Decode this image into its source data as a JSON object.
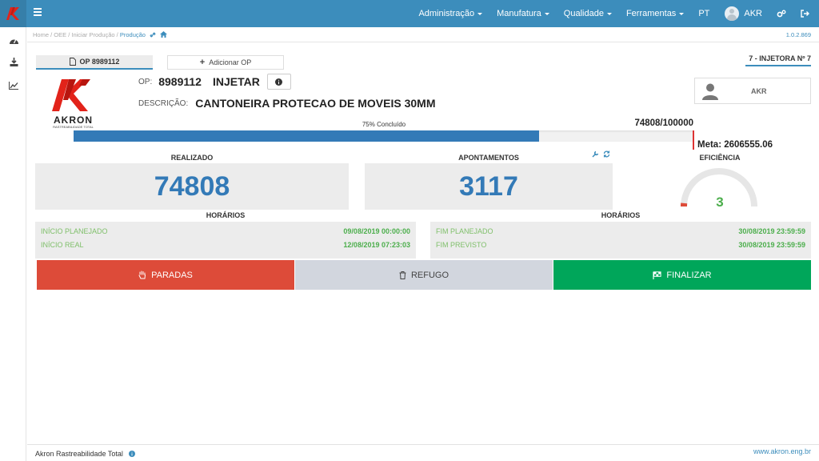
{
  "header": {
    "menu": [
      {
        "label": "Administração"
      },
      {
        "label": "Manufatura"
      },
      {
        "label": "Qualidade"
      },
      {
        "label": "Ferramentas"
      }
    ],
    "language": "PT",
    "user": "AKR"
  },
  "breadcrumb": {
    "items": [
      "Home",
      "OEE",
      "Iniciar Produção"
    ],
    "current": "Produção",
    "separator": " / "
  },
  "version": "1.0.2.869",
  "tabs": {
    "op_label": "OP 8989112",
    "add_label": "Adicionar OP"
  },
  "machine": "7 - INJETORA Nº 7",
  "brand": {
    "name": "AKRON",
    "tagline": "RASTREABILIDADE TOTAL"
  },
  "order": {
    "op_label": "OP:",
    "op_number": "8989112",
    "operation": "INJETAR",
    "desc_label": "DESCRIÇÃO:",
    "description": "CANTONEIRA PROTECAO DE MOVEIS 30MM"
  },
  "operator": {
    "name": "AKR"
  },
  "progress": {
    "label": "75% Concluído",
    "count": "74808/100000",
    "fraction": 0.75,
    "meta": "Meta: 2606555.06"
  },
  "realizado": {
    "title": "REALIZADO",
    "value": "74808"
  },
  "apontamentos": {
    "title": "APONTAMENTOS",
    "value": "3117"
  },
  "eficiencia": {
    "title": "EFICIÊNCIA",
    "value": "3",
    "fraction": 0.03
  },
  "horarios_left": {
    "title": "HORÁRIOS",
    "rows": [
      {
        "label": "INÍCIO PLANEJADO",
        "value": "09/08/2019 00:00:00"
      },
      {
        "label": "INÍCIO REAL",
        "value": "12/08/2019 07:23:03"
      }
    ]
  },
  "horarios_right": {
    "title": "HORÁRIOS",
    "rows": [
      {
        "label": "FIM PLANEJADO",
        "value": "30/08/2019 23:59:59"
      },
      {
        "label": "FIM PREVISTO",
        "value": "30/08/2019 23:59:59"
      }
    ]
  },
  "actions": {
    "paradas": "PARADAS",
    "refugo": "REFUGO",
    "finalizar": "FINALIZAR"
  },
  "footer": {
    "brand": "Akron Rastreabilidade Total",
    "url": "www.akron.eng.br"
  },
  "colors": {
    "primary": "#3c8dbc",
    "danger": "#dd4b39",
    "success": "#00a65a",
    "neutral": "#d2d6de"
  }
}
